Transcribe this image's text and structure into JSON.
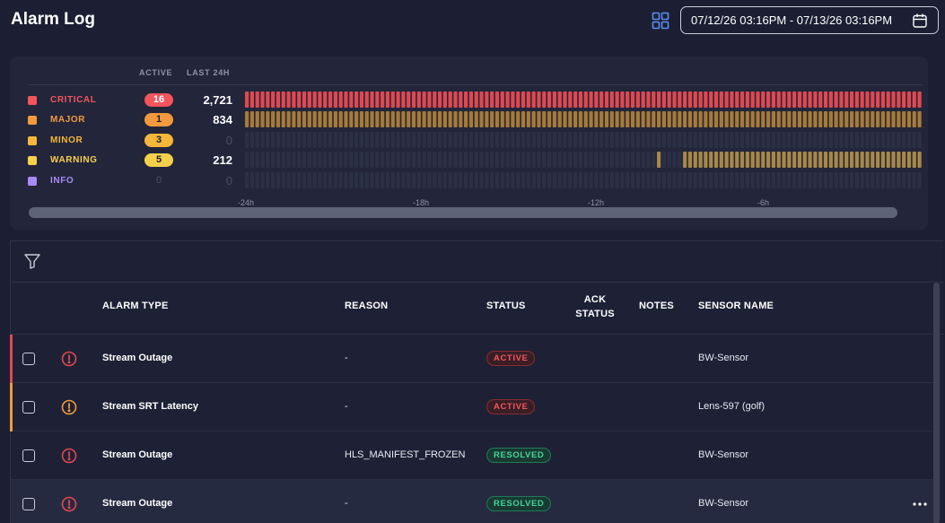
{
  "header": {
    "title": "Alarm Log",
    "date_range": "07/12/26 03:16PM - 07/13/26 03:16PM",
    "grid_icon": "grid-icon",
    "calendar_icon": "calendar-icon"
  },
  "summary": {
    "active_header": "ACTIVE",
    "last24_header": "LAST 24H",
    "severities": [
      {
        "name": "CRITICAL",
        "active": "16",
        "count": "2,721",
        "color": "#f2555b",
        "badge_text": "#ffffff",
        "bar_color": "#e0494f",
        "bars": "full"
      },
      {
        "name": "MAJOR",
        "active": "1",
        "count": "834",
        "color": "#f29a3d",
        "badge_text": "#1c1f33",
        "bar_color": "#a77a38",
        "bars": "full"
      },
      {
        "name": "MINOR",
        "active": "3",
        "count": "0",
        "color": "#f5b739",
        "badge_text": "#1c1f33",
        "bar_color": "#2e3247",
        "bars": "none"
      },
      {
        "name": "WARNING",
        "active": "5",
        "count": "212",
        "color": "#f7d04a",
        "badge_text": "#1c1f33",
        "bar_color": "#a78848",
        "bars": "partial"
      },
      {
        "name": "INFO",
        "active": "0",
        "count": "0",
        "color": "#a88bf5",
        "badge_text": "#4a4f66",
        "bar_color": "#2e3247",
        "bars": "none"
      }
    ],
    "x_ticks": [
      "-24h",
      "-18h",
      "-12h",
      "-6h"
    ]
  },
  "table": {
    "filter_icon": "filter-icon",
    "columns": {
      "alarm_type": "ALARM TYPE",
      "reason": "REASON",
      "status": "STATUS",
      "ack_status_1": "ACK",
      "ack_status_2": "STATUS",
      "notes": "NOTES",
      "sensor_name": "SENSOR NAME"
    },
    "rows": [
      {
        "alarm_type": "Stream Outage",
        "reason": "-",
        "status": "ACTIVE",
        "status_kind": "active",
        "sensor": "BW-Sensor",
        "severity_color": "#e0494f",
        "icon_color": "#e0494f"
      },
      {
        "alarm_type": "Stream SRT Latency",
        "reason": "-",
        "status": "ACTIVE",
        "status_kind": "active",
        "sensor": "Lens-597 (golf)",
        "severity_color": "#f29a3d",
        "icon_color": "#f29a3d"
      },
      {
        "alarm_type": "Stream Outage",
        "reason": "HLS_MANIFEST_FROZEN",
        "status": "RESOLVED",
        "status_kind": "resolved",
        "sensor": "BW-Sensor",
        "severity_color": "",
        "icon_color": "#e0494f"
      },
      {
        "alarm_type": "Stream Outage",
        "reason": "-",
        "status": "RESOLVED",
        "status_kind": "resolved",
        "sensor": "BW-Sensor",
        "severity_color": "",
        "icon_color": "#e0494f"
      }
    ]
  }
}
